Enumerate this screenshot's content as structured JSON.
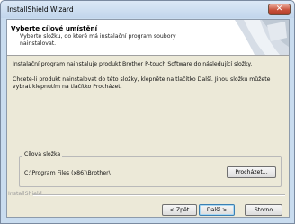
{
  "window": {
    "title": "InstallShield Wizard"
  },
  "header": {
    "title": "Vyberte cílové umístění",
    "subtitle": "Vyberte složku, do které má instalační program soubory nainstalovat."
  },
  "body": {
    "paragraph1": "Instalační program nainstaluje produkt Brother P-touch Software do následující složky.",
    "paragraph2": "Chcete-li produkt nainstalovat do této složky, klepněte na tlačítko Další. Jinou složku můžete vybrat klepnutím na tlačítko Procházet."
  },
  "destination": {
    "label": "Cílová složka",
    "path": "C:\\Program Files (x86)\\Brother\\",
    "browse_label": "Procházet..."
  },
  "footer": {
    "brand": "InstallShield",
    "back_label": "< Zpět",
    "next_label": "Další >",
    "cancel_label": "Storno"
  },
  "icons": {
    "close": "close-icon"
  },
  "colors": {
    "accent": "#3c7fb1",
    "close_button": "#c8503a"
  }
}
